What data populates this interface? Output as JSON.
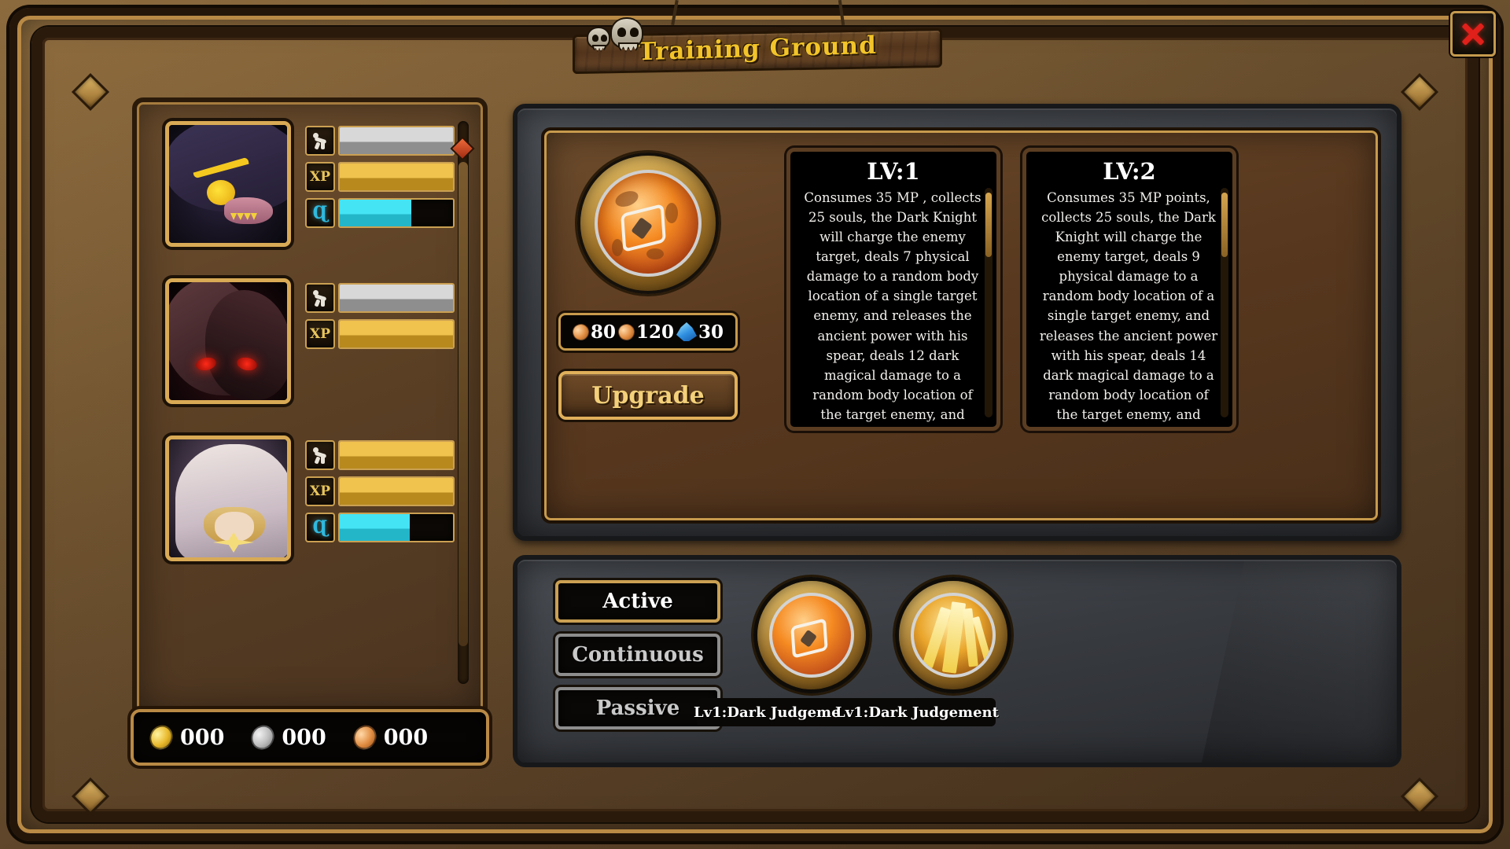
{
  "window": {
    "title": "Training Ground",
    "close_label": "×"
  },
  "heroes": [
    {
      "portrait": "wraith-portrait",
      "stats": [
        {
          "icon": "hp-icon",
          "label": "",
          "fill_pct": 100,
          "type": "hp"
        },
        {
          "icon": "xp-icon",
          "label": "XP",
          "fill_pct": 100,
          "type": "xp"
        },
        {
          "icon": "mp-icon",
          "label": "",
          "fill_pct": 63,
          "type": "mp"
        }
      ]
    },
    {
      "portrait": "beast-portrait",
      "stats": [
        {
          "icon": "hp-icon",
          "label": "",
          "fill_pct": 100,
          "type": "hp"
        },
        {
          "icon": "xp-icon",
          "label": "XP",
          "fill_pct": 100,
          "type": "xp"
        }
      ]
    },
    {
      "portrait": "priest-portrait",
      "stats": [
        {
          "icon": "hp-icon",
          "label": "",
          "fill_pct": 100,
          "type": "xp"
        },
        {
          "icon": "xp-icon",
          "label": "XP",
          "fill_pct": 100,
          "type": "xp"
        },
        {
          "icon": "mp-icon",
          "label": "",
          "fill_pct": 62,
          "type": "mp"
        }
      ]
    }
  ],
  "currency": [
    {
      "type": "gold",
      "value": "000"
    },
    {
      "type": "silver",
      "value": "000"
    },
    {
      "type": "bronze",
      "value": "000"
    }
  ],
  "skill_detail": {
    "icon_name": "dark-judgement-icon",
    "costs": [
      {
        "icon": "bronze-coin-icon",
        "value": "80"
      },
      {
        "icon": "bronze-coin-icon",
        "value": "120"
      },
      {
        "icon": "crystal-gem-icon",
        "value": "30"
      }
    ],
    "upgrade_label": "Upgrade",
    "levels": [
      {
        "title": "LV:1",
        "description": "Consumes 35 MP , collects 25 souls, the Dark Knight will charge the enemy target, deals 7 physical damage to a random body location of a single target enemy, and releases the ancient power with his spear, deals 12 dark magical damage to a random body location of the target enemy, and applies a stun effect, and increases the"
      },
      {
        "title": "LV:2",
        "description": "Consumes 35 MP points, collects 25 souls, the Dark Knight will charge the enemy target, deals 9 physical damage to a random body location of a single target enemy, and releases the ancient power with his spear, deals 14 dark magical damage to a random body location of the target enemy, and applies a stun effect, and"
      }
    ]
  },
  "skill_bar": {
    "categories": [
      {
        "label": "Active",
        "selected": true
      },
      {
        "label": "Continuous",
        "selected": false
      },
      {
        "label": "Passive",
        "selected": false
      }
    ],
    "skills": [
      {
        "name": "Lv1:Dark Judgement",
        "icon": "dark-judgement-icon"
      },
      {
        "name": "Lv1:Dark Judgement",
        "icon": "light-judgement-icon"
      }
    ]
  },
  "colors": {
    "gold": "#c79a4c",
    "gold_bright": "#f3d07a",
    "title_yellow": "#f2c42a",
    "close_red": "#e0201b",
    "panel_brown": "#59391f",
    "slate": "#3a3d42"
  }
}
